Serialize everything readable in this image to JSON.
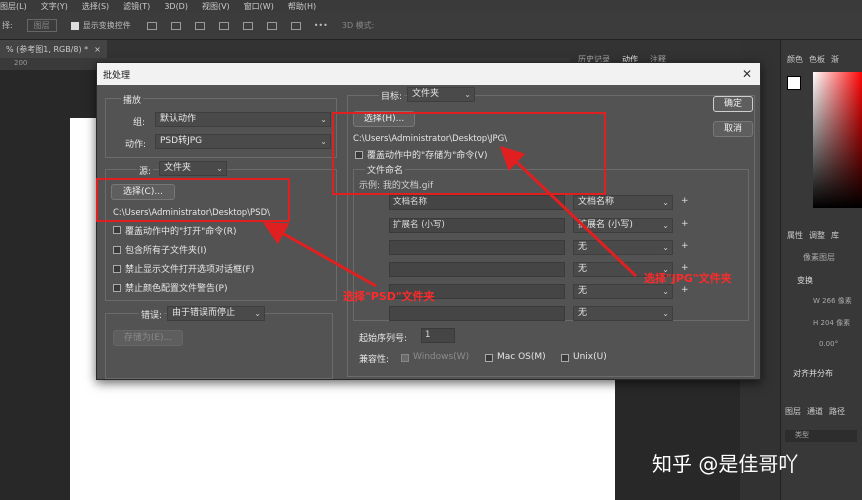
{
  "menu": [
    "图层(L)",
    "文字(Y)",
    "选择(S)",
    "滤镜(T)",
    "3D(D)",
    "视图(V)",
    "窗口(W)",
    "帮助(H)"
  ],
  "options": {
    "label_prefix": "择:",
    "field": "图层",
    "show_transform": "显示变换控件",
    "mode_3d": "3D 模式:",
    "more": "•••"
  },
  "doc_tab": {
    "title": "% (参考图1, RGB/8) *",
    "close": "×"
  },
  "ruler_mark": "200",
  "history_tabs": [
    "历史记录",
    "动作",
    "注释"
  ],
  "right_panel_tabs": [
    "颜色",
    "色板",
    "渐"
  ],
  "props": {
    "tabs": [
      "属性",
      "调整",
      "库"
    ],
    "pixel_layer": "像素图层",
    "transform": "变换",
    "w": "W",
    "w_val": "266 像素",
    "h": "H",
    "h_val": "204 像素",
    "x_val": "0.00°",
    "align": "对齐并分布"
  },
  "layers": {
    "tabs": [
      "图层",
      "通道",
      "路径"
    ],
    "type_label": "类型"
  },
  "dialog": {
    "title": "批处理",
    "close": "✕",
    "ok": "确定",
    "cancel": "取消",
    "play": {
      "heading": "播放",
      "group_label": "组:",
      "group_value": "默认动作",
      "action_label": "动作:",
      "action_value": "PSD转JPG"
    },
    "source": {
      "label": "源:",
      "value": "文件夹",
      "choose": "选择(C)...",
      "path": "C:\\Users\\Administrator\\Desktop\\PSD\\",
      "options": [
        "覆盖动作中的\"打开\"命令(R)",
        "包含所有子文件夹(I)",
        "禁止显示文件打开选项对话框(F)",
        "禁止颜色配置文件警告(P)"
      ]
    },
    "error": {
      "label": "错误:",
      "value": "由于错误而停止",
      "save_as": "存储为(E)..."
    },
    "target": {
      "label": "目标:",
      "value": "文件夹",
      "choose": "选择(H)...",
      "path": "C:\\Users\\Administrator\\Desktop\\JPG\\",
      "override": "覆盖动作中的\"存储为\"命令(V)",
      "naming_heading": "文件命名",
      "example": "示例: 我的文档.gif",
      "rows": [
        {
          "field": "文档名称",
          "select": "文档名称"
        },
        {
          "field": "扩展名 (小写)",
          "select": "扩展名 (小写)"
        },
        {
          "field": "",
          "select": "无"
        },
        {
          "field": "",
          "select": "无"
        },
        {
          "field": "",
          "select": "无"
        },
        {
          "field": "",
          "select": "无"
        }
      ],
      "plus": "+",
      "start_serial_label": "起始序列号:",
      "start_serial_value": "1",
      "compat_label": "兼容性:",
      "compat": [
        "Windows(W)",
        "Mac OS(M)",
        "Unix(U)"
      ]
    }
  },
  "annotations": {
    "psd": "选择\"PSD\"文件夹",
    "jpg": "选择\"JPG\"文件夹"
  },
  "watermark": "知乎 @是佳哥吖",
  "colors": {
    "annotation_red": "#e02020",
    "dialog_bg": "#535353"
  }
}
